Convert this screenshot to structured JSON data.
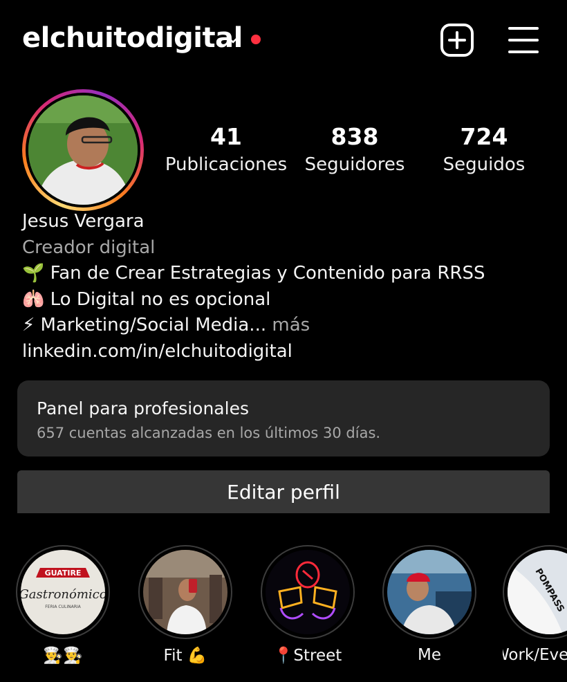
{
  "header": {
    "username": "elchuitodigital",
    "notification_color": "#ff3040"
  },
  "profile": {
    "stats": [
      {
        "count": "41",
        "label": "Publicaciones"
      },
      {
        "count": "838",
        "label": "Seguidores"
      },
      {
        "count": "724",
        "label": "Seguidos"
      }
    ],
    "name": "Jesus Vergara",
    "category": "Creador digital",
    "bio": [
      "🌱 Fan de Crear Estrategias y Contenido para RRSS",
      "🫁 Lo Digital no es opcional",
      "⚡ Marketing/Social Media..."
    ],
    "more_label": "más",
    "link": "linkedin.com/in/elchuitodigital"
  },
  "dashboard": {
    "title": "Panel para profesionales",
    "subtitle": "657 cuentas alcanzadas en los últimos 30 días."
  },
  "edit_button": "Editar perfil",
  "highlights": [
    {
      "label": "👨‍🍳👨‍🍳",
      "cover_text_top": "GUATIRE",
      "cover_text_main": "Gastronómico",
      "cover_text_sub": "FERIA CULINARIA"
    },
    {
      "label": "Fit 💪"
    },
    {
      "label": "📍Street"
    },
    {
      "label": "Me"
    },
    {
      "label": "Work/Even",
      "cover_text": "POMPASS"
    }
  ],
  "colors": {
    "background": "#000000",
    "panel": "#262626",
    "button": "#363636",
    "secondary_text": "#a8a8a8"
  }
}
